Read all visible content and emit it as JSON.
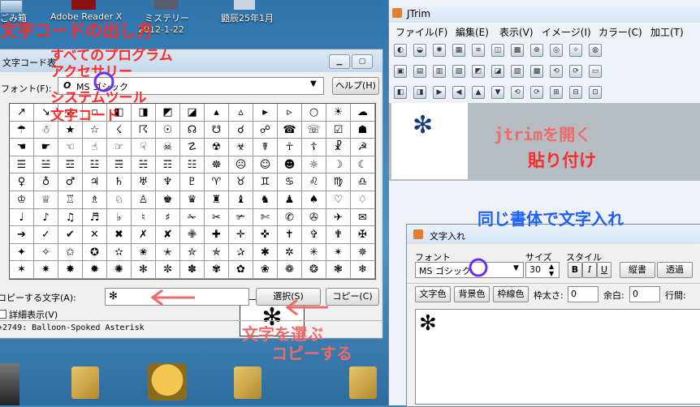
{
  "desktop": {
    "icons": [
      {
        "label": "ごみ箱"
      },
      {
        "label": "Adobe Reader X"
      },
      {
        "label": "ミステリー"
      },
      {
        "label": "鼯辰25年1月"
      }
    ],
    "date_label": "2012-1-22"
  },
  "charmap": {
    "title": "文字コード表",
    "font_label": "フォント(F):",
    "font_value": "MS ゴシック",
    "font_prefix": "O",
    "help_button": "ヘルプ(H)",
    "copy_label": "コピーする文字(A):",
    "copy_value": "✻",
    "select_button": "選択(S)",
    "copy_button": "コピー(C)",
    "detail_checkbox": "詳細表示(V)",
    "status": "+2749: Balloon-Spoked Asterisk",
    "zoom_char": "✻",
    "grid_rows": [
      [
        "↗",
        "↘",
        "↙",
        "▫",
        "◧",
        "◨",
        "◩",
        "◪",
        "▴",
        "▵",
        "▸",
        "▹",
        "○",
        "☀",
        "☁"
      ],
      [
        "☂",
        "☃",
        "★",
        "☆",
        "☇",
        "☈",
        "☉",
        "☊",
        "☋",
        "☌",
        "☍",
        "☎",
        "☏",
        "☑",
        "☗"
      ],
      [
        "☚",
        "☛",
        "☜",
        "☝",
        "☞",
        "☟",
        "☠",
        "☡",
        "☢",
        "☣",
        "☤",
        "☥",
        "☦",
        "☧",
        "☭"
      ],
      [
        "☰",
        "☱",
        "☲",
        "☳",
        "☴",
        "☵",
        "☶",
        "☷",
        "☸",
        "☹",
        "☺",
        "☻",
        "☼",
        "☽",
        "☾"
      ],
      [
        "♀",
        "♁",
        "♂",
        "♃",
        "♄",
        "♅",
        "♆",
        "♇",
        "♈",
        "♉",
        "♊",
        "♋",
        "♌",
        "♍",
        "♎"
      ],
      [
        "♔",
        "♕",
        "♖",
        "♗",
        "♘",
        "♙",
        "♚",
        "♛",
        "♜",
        "♝",
        "♞",
        "♟",
        "♠",
        "♡",
        "♢"
      ],
      [
        "♩",
        "♪",
        "♫",
        "♬",
        "♭",
        "♮",
        "♯",
        "✁",
        "✂",
        "✃",
        "✄",
        "✆",
        "✇",
        "✈",
        "✉"
      ],
      [
        "➔",
        "✓",
        "✔",
        "✕",
        "✖",
        "✗",
        "✘",
        "✙",
        "✚",
        "✛",
        "✜",
        "✝",
        "✞",
        "✟",
        "✠"
      ],
      [
        "✦",
        "✧",
        "✩",
        "✪",
        "✫",
        "✬",
        "✭",
        "✮",
        "✯",
        "✰",
        "✱",
        "✲",
        "✳",
        "✴",
        "✵"
      ],
      [
        "✶",
        "✷",
        "✸",
        "✹",
        "✺",
        "✻",
        "✼",
        "✽",
        "✾",
        "✿",
        "❀",
        "❁",
        "❂",
        "❃",
        "❄"
      ]
    ]
  },
  "jtrim": {
    "title": "JTrim",
    "menu": [
      "ファイル(F)",
      "編集(E)",
      "表示(V)",
      "イメージ(I)",
      "カラー(C)",
      "加工(T)"
    ],
    "canvas_char": "✻"
  },
  "text_dialog": {
    "title": "文字入れ",
    "font_label": "フォント",
    "size_label": "サイズ",
    "style_label": "スタイル",
    "font_value": "MS ゴシック",
    "size_value": "30",
    "bold": "B",
    "italic": "I",
    "underline": "U",
    "vertical": "縦書",
    "transparent": "透過",
    "text_color": "文字色",
    "bg_color": "背景色",
    "border_color": "枠線色",
    "border_width_label": "枠太さ:",
    "border_width": "0",
    "margin_label": "余白:",
    "margin": "0",
    "line_label": "行間:",
    "preview_char": "✻"
  },
  "annotations": {
    "title": "文字コードの出し方",
    "step1": "すべてのプログラム",
    "step2": "アクセサリー",
    "step3": "システムツール",
    "step4": "文字コード",
    "select_hint": "文字を選ぶ",
    "copy_hint": "コピーする",
    "open_jtrim": "jtrimを開く",
    "paste": "貼り付け",
    "same_font": "同じ書体で文字入れ"
  },
  "colors": {
    "annotation_red": "#ff2a2a",
    "annotation_salmon": "#f06a6a",
    "annotation_blue": "#1e5fff",
    "circle_purple": "#6a2cff"
  }
}
